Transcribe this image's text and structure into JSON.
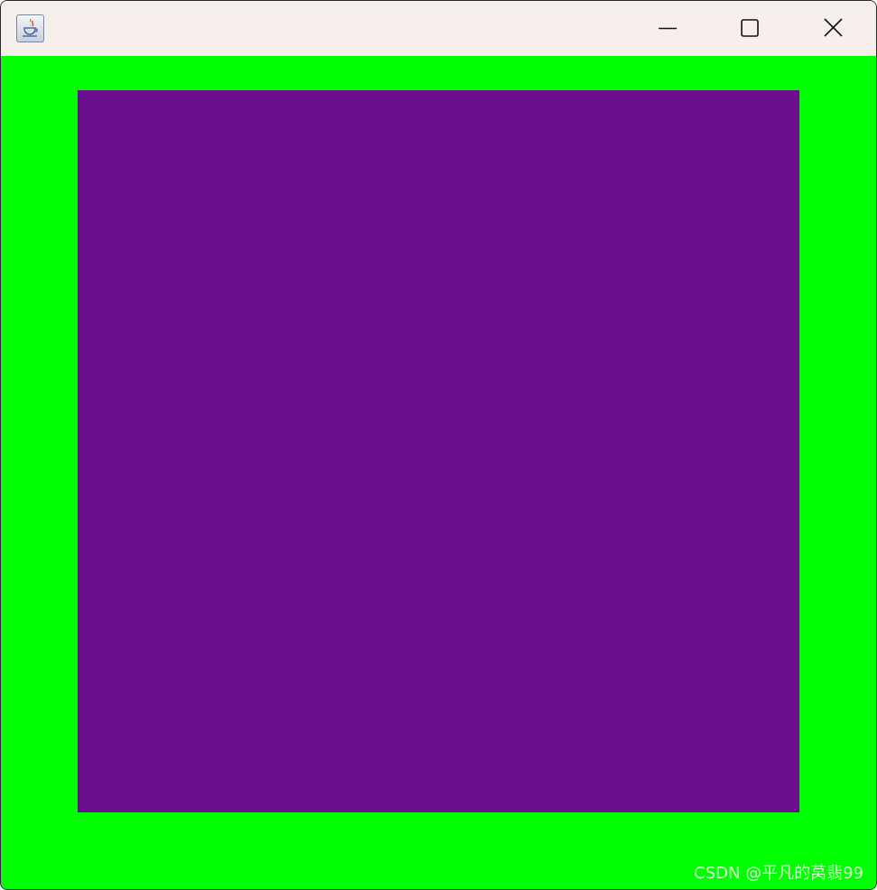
{
  "window": {
    "title": "",
    "controls": {
      "minimize_icon": "minimize-icon",
      "maximize_icon": "maximize-icon",
      "close_icon": "close-icon"
    },
    "app_icon": "java-cup-icon"
  },
  "canvas": {
    "background_color": "#00ff00",
    "square_color": "#6a0f8e"
  },
  "watermark": {
    "text": "CSDN @平凡的莴翡99"
  }
}
